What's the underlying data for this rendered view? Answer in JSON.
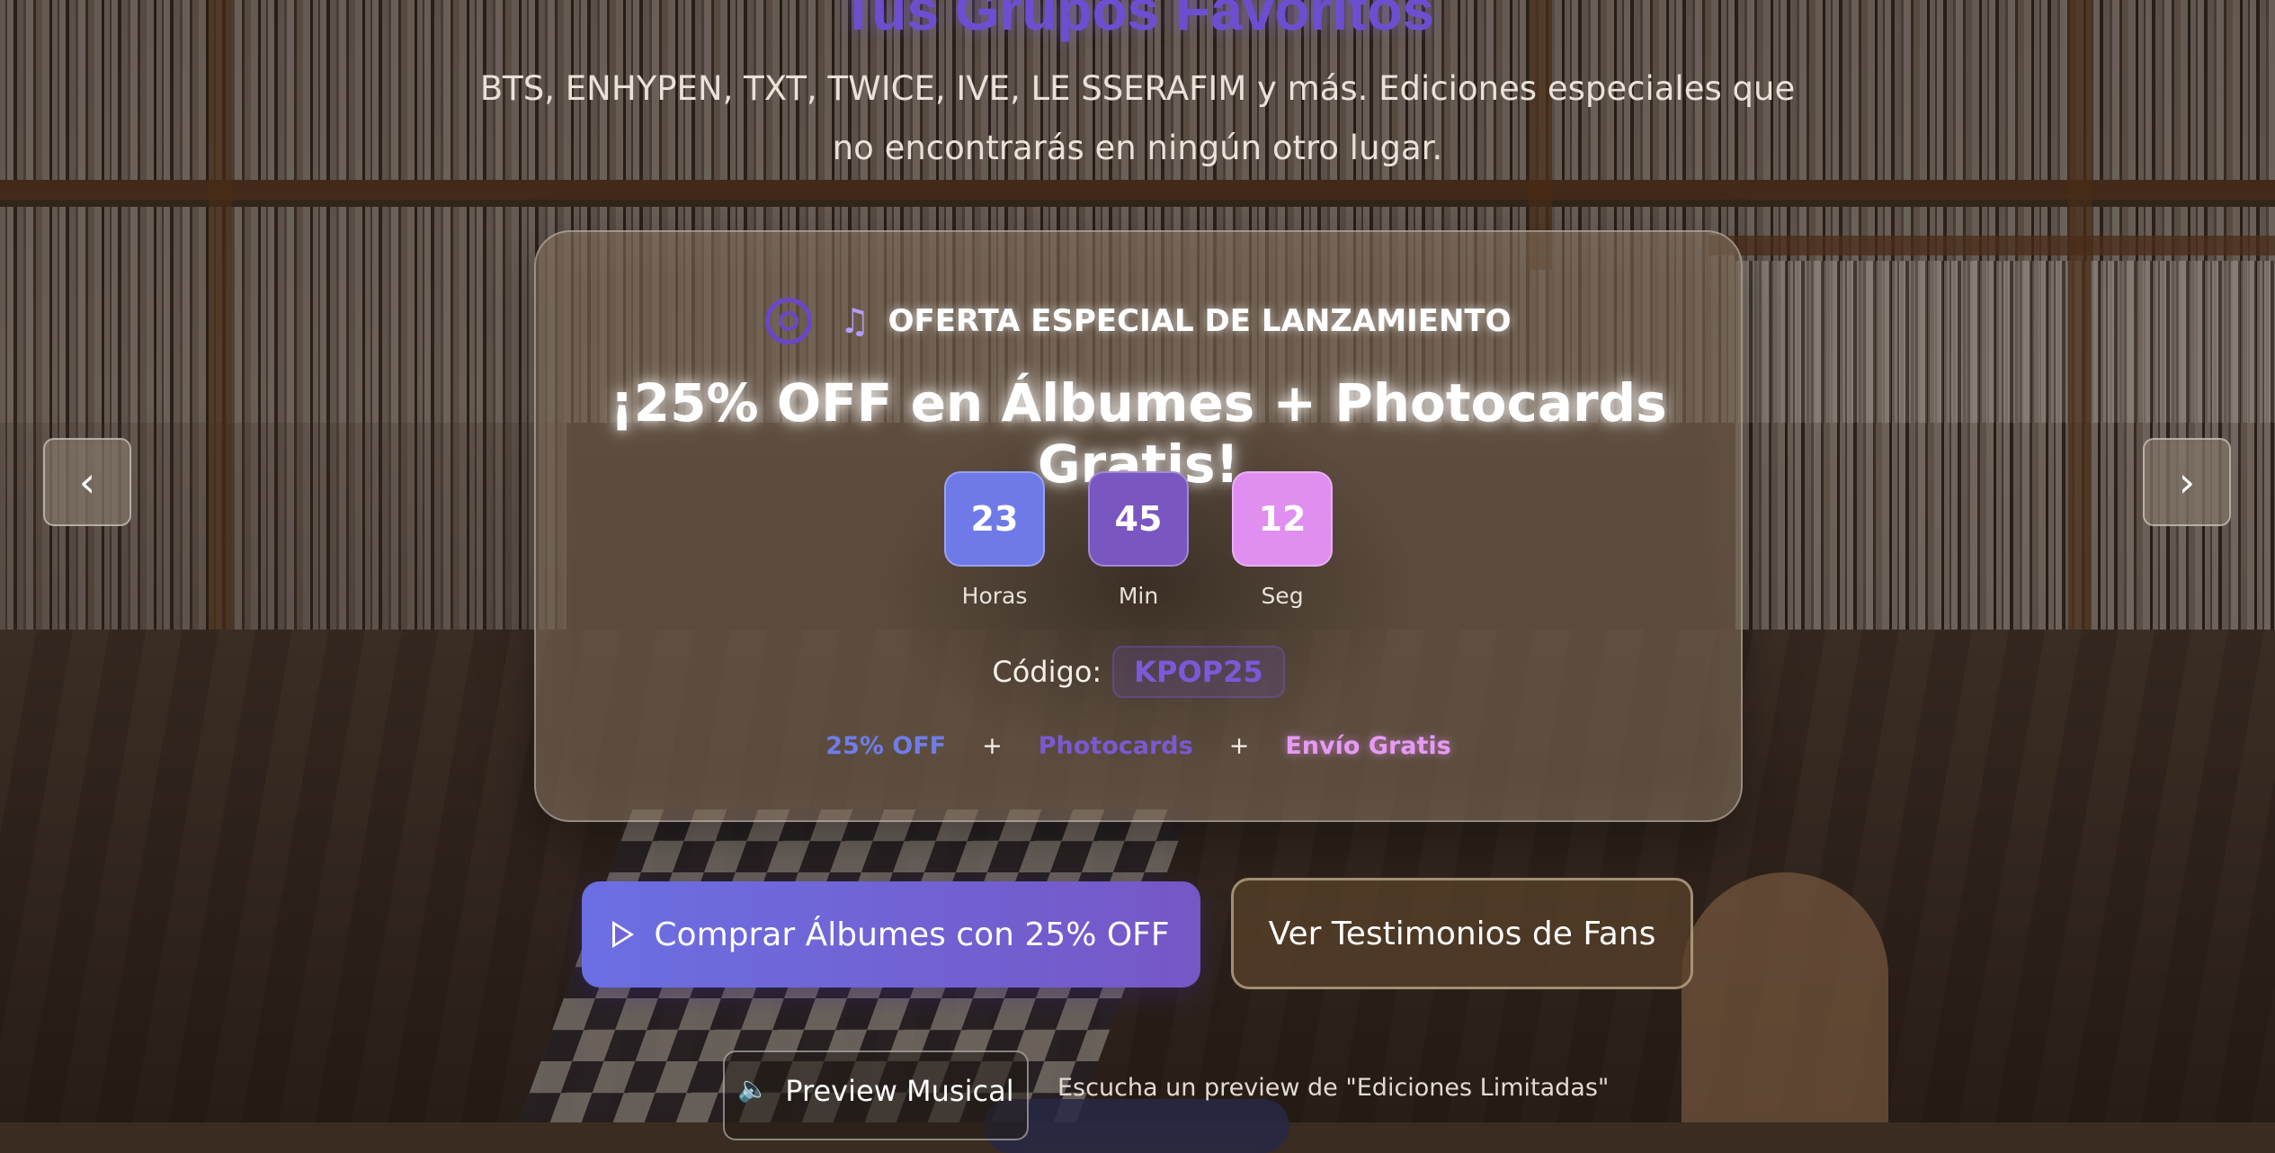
{
  "hero": {
    "title": "Tus Grupos Favoritos",
    "subtitle": "BTS, ENHYPEN, TXT, TWICE, IVE, LE SSERAFIM y más. Ediciones especiales que no encontrarás en ningún otro lugar."
  },
  "promo": {
    "tag": "OFERTA ESPECIAL DE LANZAMIENTO",
    "title": "¡25% OFF en Álbumes + Photocards Gratis!",
    "countdown": [
      {
        "value": "23",
        "label": "Horas",
        "color": "#6f7ae8"
      },
      {
        "value": "45",
        "label": "Min",
        "color": "#7a56c0"
      },
      {
        "value": "12",
        "label": "Seg",
        "color": "#e08ef0"
      }
    ],
    "code_label": "Código:",
    "code_value": "KPOP25",
    "perks": [
      {
        "label": "25% OFF",
        "color": "#6e7de8"
      },
      {
        "label": "Photocards",
        "color": "#7b59d2"
      },
      {
        "label": "Envío Gratis",
        "color": "#e79af5"
      }
    ],
    "plus": "+"
  },
  "nav": {
    "prev_icon": "chevron-left-icon",
    "next_icon": "chevron-right-icon"
  },
  "cta": {
    "primary_label": "Comprar Álbumes con 25% OFF",
    "secondary_label": "Ver Testimonios de Fans"
  },
  "preview": {
    "button_label": "Preview Musical",
    "caption": "Escucha un preview de \"Ediciones Limitadas\""
  },
  "colors": {
    "accent": "#6b6fe3",
    "accent_purple": "#7657c6",
    "pink": "#e08ef0"
  }
}
